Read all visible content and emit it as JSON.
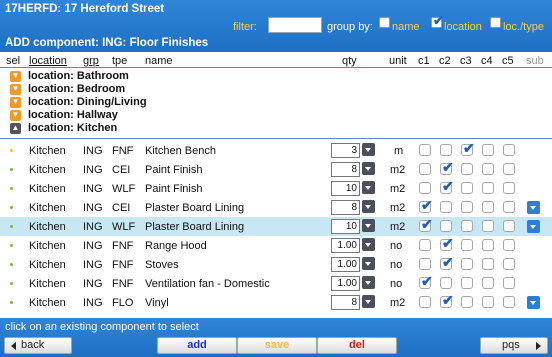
{
  "header": {
    "title": "17HERFD: 17 Hereford Street",
    "subtitle": "ADD component: ING: Floor Finishes",
    "filter_label": "filter:",
    "filter_value": "",
    "group_by_label": "group by:",
    "group_options": [
      {
        "label": "name",
        "checked": false
      },
      {
        "label": "location",
        "checked": true
      },
      {
        "label": "loc./type",
        "checked": false
      }
    ]
  },
  "columns": {
    "sel": "sel",
    "location": "location",
    "grp": "grp",
    "tpe": "tpe",
    "name": "name",
    "qty": "qty",
    "unit": "unit",
    "c1": "c1",
    "c2": "c2",
    "c3": "c3",
    "c4": "c4",
    "c5": "c5",
    "sub": "sub"
  },
  "groups": [
    {
      "label": "location: Bathroom",
      "expanded": false
    },
    {
      "label": "location: Bedroom",
      "expanded": false
    },
    {
      "label": "location: Dining/Living",
      "expanded": false
    },
    {
      "label": "location: Hallway",
      "expanded": false
    },
    {
      "label": "location: Kitchen",
      "expanded": true
    }
  ],
  "rows": [
    {
      "location": "Kitchen",
      "grp": "ING",
      "tpe": "FNF",
      "name": "Kitchen Bench",
      "qty": "3",
      "unit": "m",
      "checks": [
        false,
        false,
        true,
        false,
        false
      ],
      "sub": false,
      "selected": false,
      "dot_color": "#f3c628"
    },
    {
      "location": "Kitchen",
      "grp": "ING",
      "tpe": "CEI",
      "name": "Paint Finish",
      "qty": "8",
      "unit": "m2",
      "checks": [
        false,
        true,
        false,
        false,
        false
      ],
      "sub": false,
      "selected": false,
      "dot_color": "#7cbf3a"
    },
    {
      "location": "Kitchen",
      "grp": "ING",
      "tpe": "WLF",
      "name": "Paint Finish",
      "qty": "10",
      "unit": "m2",
      "checks": [
        false,
        true,
        false,
        false,
        false
      ],
      "sub": false,
      "selected": false,
      "dot_color": "#7cbf3a"
    },
    {
      "location": "Kitchen",
      "grp": "ING",
      "tpe": "CEI",
      "name": "Plaster Board Lining",
      "qty": "8",
      "unit": "m2",
      "checks": [
        true,
        false,
        false,
        false,
        false
      ],
      "sub": true,
      "selected": false,
      "dot_color": "#7cbf3a"
    },
    {
      "location": "Kitchen",
      "grp": "ING",
      "tpe": "WLF",
      "name": "Plaster Board Lining",
      "qty": "10",
      "unit": "m2",
      "checks": [
        true,
        false,
        false,
        false,
        false
      ],
      "sub": true,
      "selected": true,
      "dot_color": "#7cbf3a"
    },
    {
      "location": "Kitchen",
      "grp": "ING",
      "tpe": "FNF",
      "name": "Range Hood",
      "qty": "1.00",
      "unit": "no",
      "checks": [
        false,
        true,
        false,
        false,
        false
      ],
      "sub": false,
      "selected": false,
      "dot_color": "#7cbf3a"
    },
    {
      "location": "Kitchen",
      "grp": "ING",
      "tpe": "FNF",
      "name": "Stoves",
      "qty": "1.00",
      "unit": "no",
      "checks": [
        false,
        true,
        false,
        false,
        false
      ],
      "sub": false,
      "selected": false,
      "dot_color": "#7cbf3a"
    },
    {
      "location": "Kitchen",
      "grp": "ING",
      "tpe": "FNF",
      "name": "Ventilation fan - Domestic",
      "qty": "1.00",
      "unit": "no",
      "checks": [
        true,
        false,
        false,
        false,
        false
      ],
      "sub": false,
      "selected": false,
      "dot_color": "#7cbf3a"
    },
    {
      "location": "Kitchen",
      "grp": "ING",
      "tpe": "FLO",
      "name": "Vinyl",
      "qty": "8",
      "unit": "m2",
      "checks": [
        false,
        true,
        false,
        false,
        false
      ],
      "sub": true,
      "selected": false,
      "dot_color": "#7cbf3a"
    }
  ],
  "footer": {
    "hint": "click on an existing component to select",
    "back": "back",
    "add": "add",
    "save": "save",
    "del": "del",
    "pqs": "pqs"
  }
}
